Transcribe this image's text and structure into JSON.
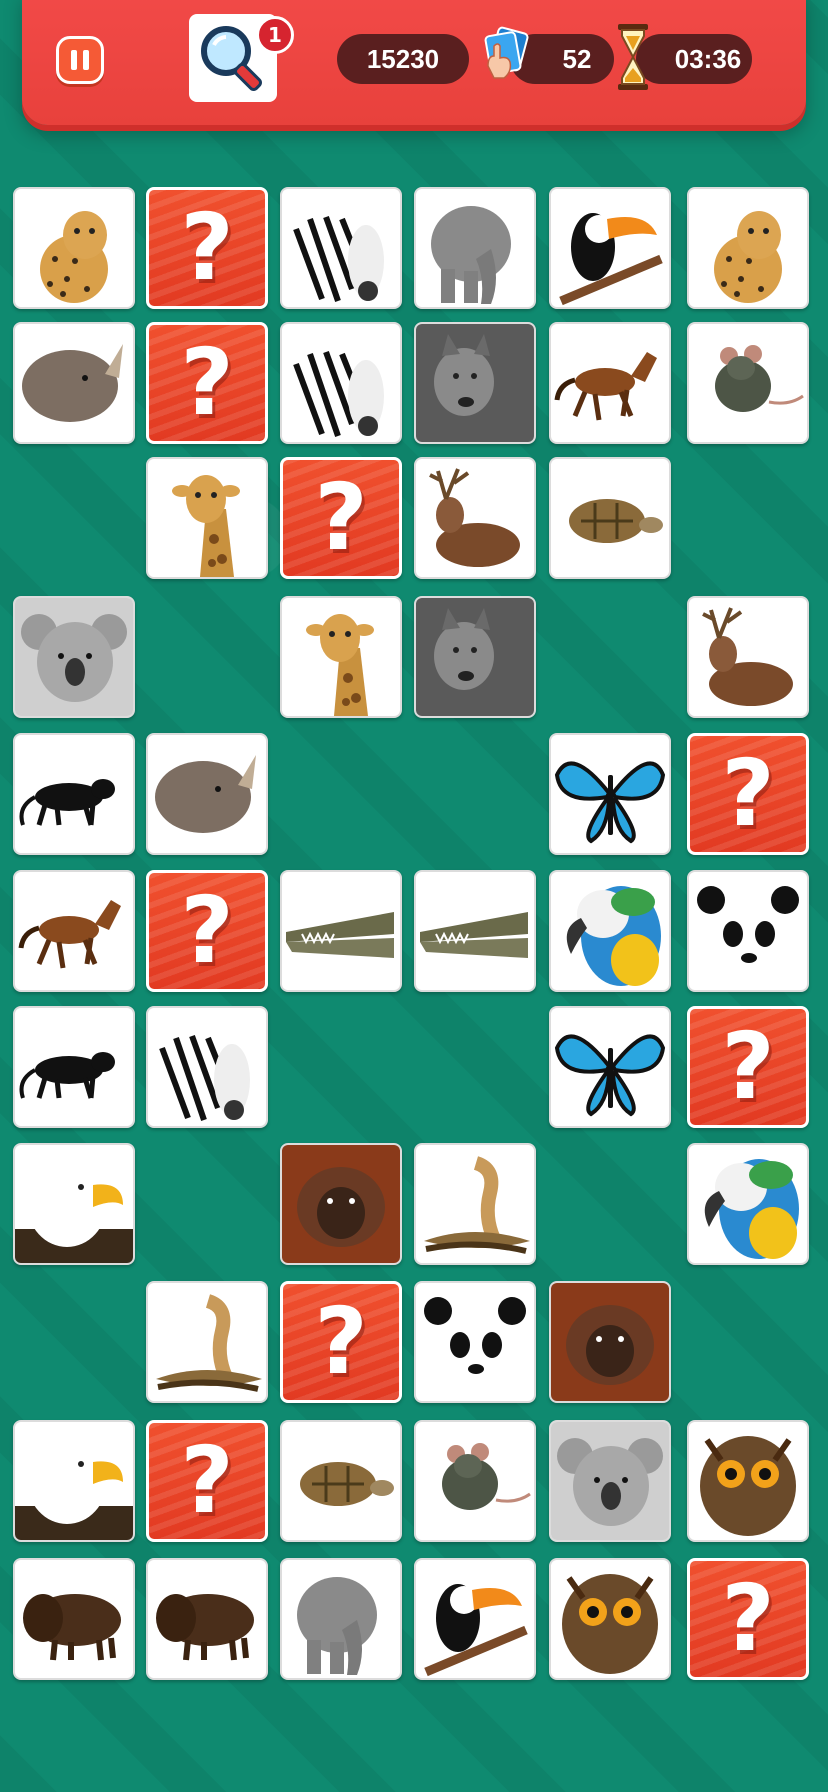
{
  "header": {
    "hint_count": "1",
    "score": "15230",
    "moves": "52",
    "timer": "03:36"
  },
  "colors": {
    "background": "#0f8a70",
    "header": "#ef4642",
    "pill": "#5a1f1f",
    "hidden_card": "#e8432a"
  },
  "board": {
    "rows": [
      [
        "cheetah",
        "hidden",
        "zebra",
        "elephant",
        "toucan",
        "cheetah"
      ],
      [
        "rhino",
        "hidden",
        "zebra",
        "wolf",
        "horse",
        "rat"
      ],
      [
        null,
        "giraffe",
        "hidden",
        "deer",
        "tortoise",
        null
      ],
      [
        "koala",
        null,
        "giraffe",
        "wolf",
        null,
        "deer"
      ],
      [
        "panther",
        "rhino",
        null,
        null,
        "butterfly",
        "hidden"
      ],
      [
        "horse",
        "hidden",
        "crocodile",
        "crocodile",
        "parrot",
        "panda"
      ],
      [
        "panther",
        "zebra",
        null,
        null,
        "butterfly",
        "hidden"
      ],
      [
        "eagle",
        null,
        "orangutan",
        "cobra",
        null,
        "parrot"
      ],
      [
        null,
        "cobra",
        "hidden",
        "panda",
        "orangutan",
        null
      ],
      [
        "eagle",
        "hidden",
        "tortoise",
        "rat",
        "koala",
        "owl"
      ],
      [
        "bison",
        "bison",
        "elephant",
        "toucan",
        "owl",
        "hidden"
      ]
    ]
  }
}
